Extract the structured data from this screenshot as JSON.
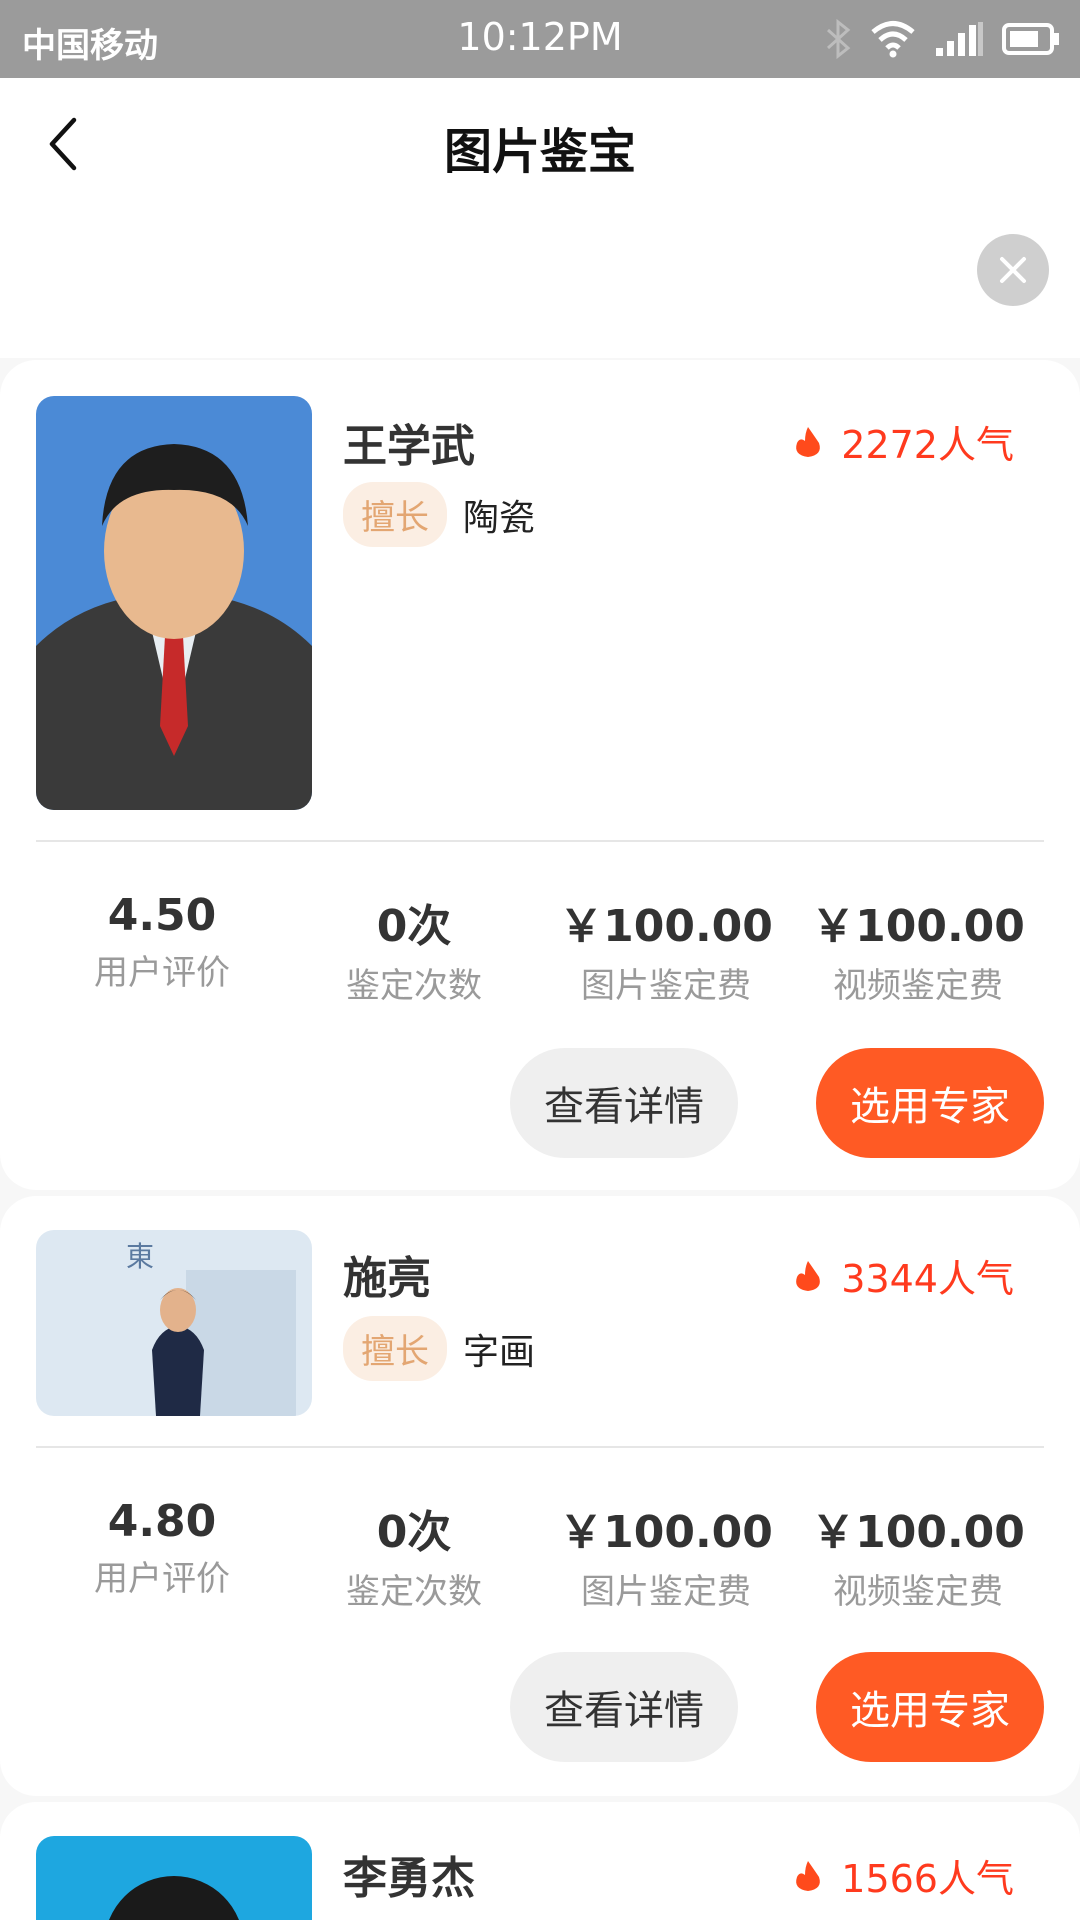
{
  "status_bar": {
    "carrier": "中国移动",
    "time": "10:12PM"
  },
  "header": {
    "title": "图片鉴宝"
  },
  "experts": [
    {
      "name": "王学武",
      "popularity": "2272人气",
      "specialty_tag": "擅长",
      "specialty": "陶瓷",
      "stats": [
        {
          "value": "4.50",
          "label": "用户评价"
        },
        {
          "value": "0次",
          "label": "鉴定次数"
        },
        {
          "value": "￥100.00",
          "label": "图片鉴定费"
        },
        {
          "value": "￥100.00",
          "label": "视频鉴定费"
        }
      ],
      "detail_label": "查看详情",
      "select_label": "选用专家"
    },
    {
      "name": "施亮",
      "popularity": "3344人气",
      "specialty_tag": "擅长",
      "specialty": "字画",
      "stats": [
        {
          "value": "4.80",
          "label": "用户评价"
        },
        {
          "value": "0次",
          "label": "鉴定次数"
        },
        {
          "value": "￥100.00",
          "label": "图片鉴定费"
        },
        {
          "value": "￥100.00",
          "label": "视频鉴定费"
        }
      ],
      "detail_label": "查看详情",
      "select_label": "选用专家"
    },
    {
      "name": "李勇杰",
      "popularity": "1566人气"
    }
  ],
  "colors": {
    "accent": "#ff5a24",
    "popularity": "#ff3a1e",
    "tag_bg": "#fbeee3",
    "tag_text": "#e3a672"
  }
}
